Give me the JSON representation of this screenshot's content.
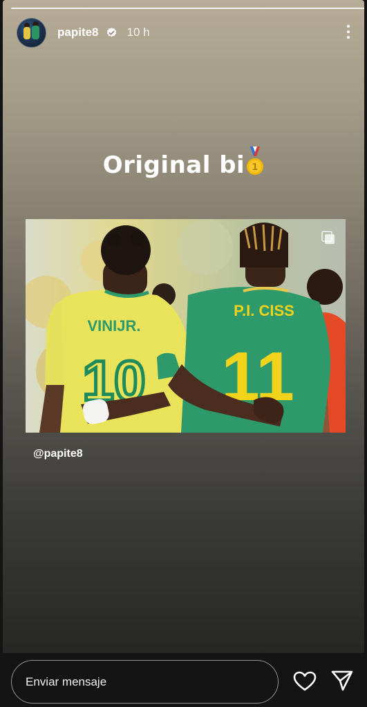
{
  "story": {
    "username": "papite8",
    "time": "10 h",
    "caption_text": "Original bi",
    "mention": "@papite8",
    "progress": 1.0
  },
  "photo": {
    "left_player_jersey_name": "VINIJR.",
    "left_player_number": "10",
    "right_player_jersey_name": "P.I. CISS",
    "right_player_number": "11"
  },
  "reply": {
    "placeholder": "Enviar mensaje"
  },
  "icons": {
    "verified": "verified-badge-icon",
    "more": "more-vertical-icon",
    "medal": "gold-medal-icon",
    "repost": "repost-icon",
    "like": "heart-icon",
    "send": "send-icon"
  },
  "colors": {
    "brazil_yellow": "#e8e35a",
    "senegal_green": "#2e9a6b",
    "jersey_number_green": "#1f8a5a",
    "jersey_number_yellow": "#f2d31b"
  }
}
